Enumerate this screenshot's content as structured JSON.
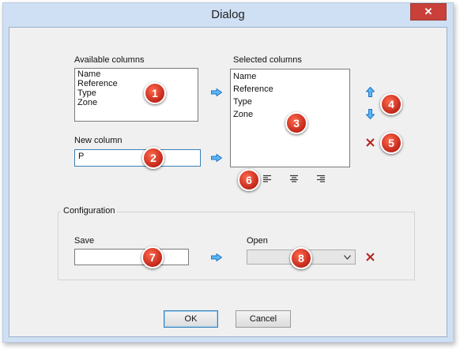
{
  "window": {
    "title": "Dialog",
    "close_glyph": "✕"
  },
  "available": {
    "label": "Available columns",
    "items": [
      "Name",
      "Reference",
      "Type",
      "Zone"
    ]
  },
  "new_column": {
    "label": "New column",
    "value": "P"
  },
  "selected": {
    "label": "Selected columns",
    "items": [
      "Name",
      "Reference",
      "Type",
      "Zone"
    ]
  },
  "configuration": {
    "label": "Configuration",
    "save_label": "Save",
    "save_value": "",
    "open_label": "Open",
    "open_value": ""
  },
  "callouts": [
    "1",
    "2",
    "3",
    "4",
    "5",
    "6",
    "7",
    "8"
  ],
  "buttons": {
    "ok": "OK",
    "cancel": "Cancel"
  },
  "colors": {
    "arrow_fill": "#5bb8f5",
    "arrow_stroke": "#1f73c8",
    "delete": "#b3261e",
    "callout": "#d3311f"
  },
  "icons": {
    "add_available": "arrow-right-icon",
    "add_new": "arrow-right-icon",
    "move_up": "arrow-up-icon",
    "move_down": "arrow-down-icon",
    "delete_column": "delete-x-icon",
    "align_left": "align-left-icon",
    "align_center": "align-center-icon",
    "align_right": "align-right-icon",
    "save_config": "arrow-right-icon",
    "delete_config": "delete-x-icon"
  }
}
